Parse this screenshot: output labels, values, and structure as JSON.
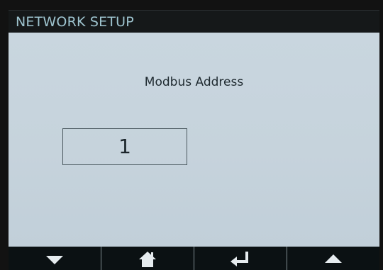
{
  "header": {
    "title": "NETWORK SETUP"
  },
  "field": {
    "label": "Modbus Address",
    "value": "1"
  },
  "toolbar": {
    "buttons": [
      {
        "icon": "arrow-down-icon"
      },
      {
        "icon": "home-icon"
      },
      {
        "icon": "enter-icon"
      },
      {
        "icon": "arrow-up-icon"
      }
    ]
  },
  "colors": {
    "title_text": "#9ec4cf",
    "screen_background": "#c9d6df",
    "toolbar_background": "#0b1113"
  }
}
